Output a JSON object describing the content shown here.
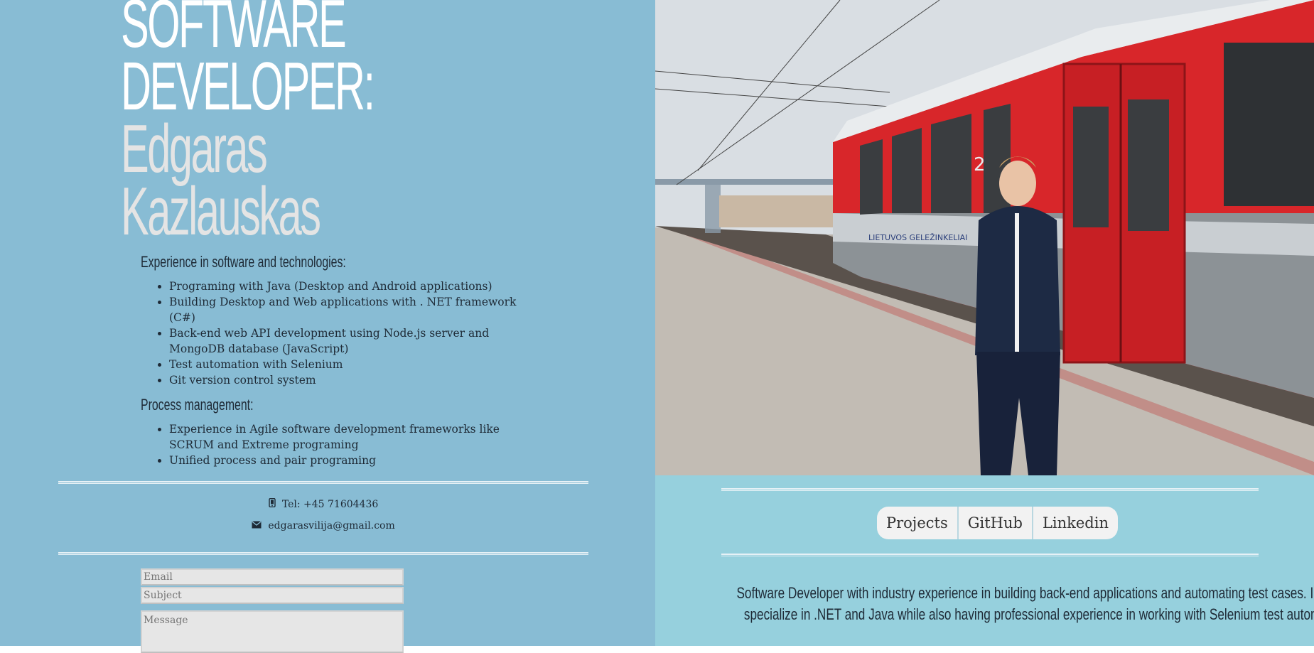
{
  "header": {
    "role_line1": "SOFTWARE",
    "role_line2": "DEVELOPER:",
    "name_line1": "Edgaras",
    "name_line2": "Kazlauskas"
  },
  "experience": {
    "title": "Experience in software and technologies:",
    "items": [
      "Programing with Java (Desktop and Android applications)",
      "Building Desktop and Web applications with . NET framework (C#)",
      "Back-end web API development using Node.js server and MongoDB database (JavaScript)",
      "Test automation with Selenium",
      "Git version control system"
    ]
  },
  "process": {
    "title": "Process management:",
    "items": [
      "Experience in Agile software development frameworks like SCRUM and Extreme programing",
      "Unified process and pair programing"
    ]
  },
  "contact": {
    "phone_icon": "phone-icon",
    "phone": "Tel: +45 71604436",
    "email_icon": "envelope-icon",
    "email": "edgarasvilija@gmail.com"
  },
  "form": {
    "email_placeholder": "Email",
    "subject_placeholder": "Subject",
    "message_placeholder": "Message"
  },
  "photo": {
    "train_brand": "LIETUVOS GELEŽINKELIAI",
    "car_number": "2"
  },
  "nav": {
    "projects": "Projects",
    "github": "GitHub",
    "linkedin": "Linkedin"
  },
  "bio": {
    "line1": "Software Developer with industry experience in building back-end applications and automating test cases. I",
    "line2": "specialize in .NET and Java while also having professional experience in working with Selenium test automation tool."
  },
  "colors": {
    "left_bg": "#88bcd4",
    "right_bg": "#96d0dd",
    "train_red": "#d8262a"
  }
}
